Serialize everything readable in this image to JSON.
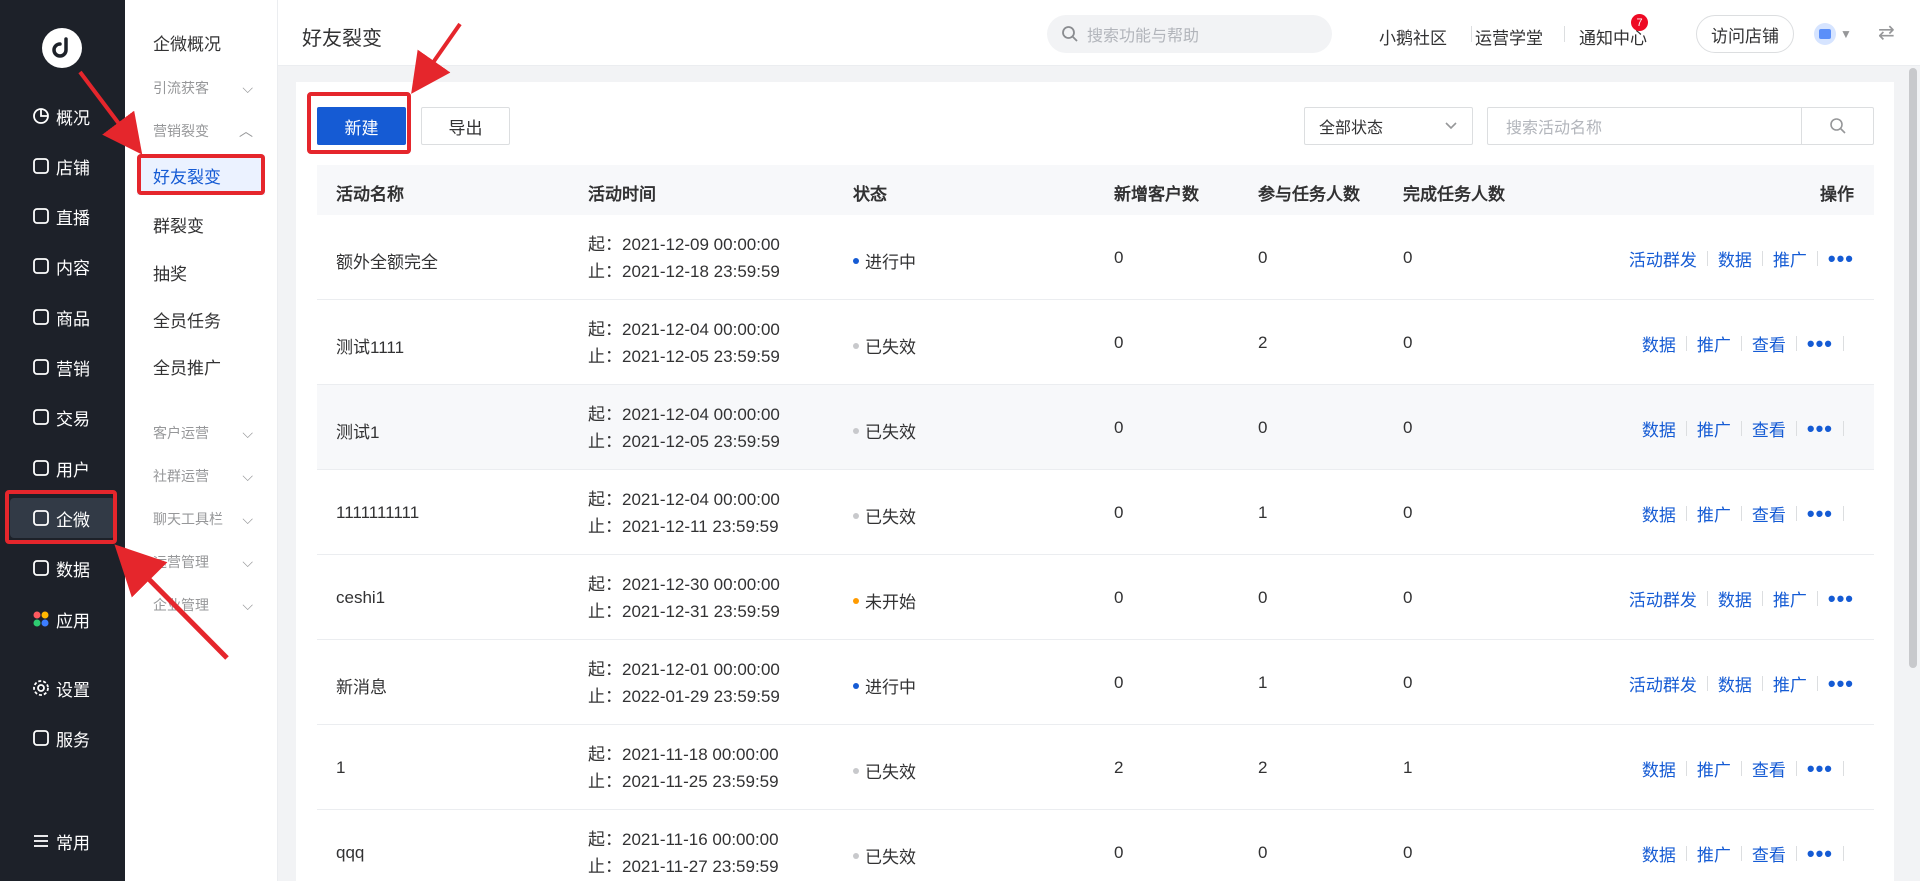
{
  "primary_nav": [
    {
      "label": "概况",
      "icon": "pie-chart-icon"
    },
    {
      "label": "店铺",
      "icon": "store-icon"
    },
    {
      "label": "直播",
      "icon": "live-icon"
    },
    {
      "label": "内容",
      "icon": "document-icon"
    },
    {
      "label": "商品",
      "icon": "product-icon"
    },
    {
      "label": "营销",
      "icon": "megaphone-icon"
    },
    {
      "label": "交易",
      "icon": "transaction-icon"
    },
    {
      "label": "用户",
      "icon": "user-icon"
    },
    {
      "label": "企微",
      "icon": "wecom-icon"
    },
    {
      "label": "数据",
      "icon": "data-icon"
    },
    {
      "label": "应用",
      "icon": "apps-icon"
    },
    {
      "label": "设置",
      "icon": "gear-icon"
    },
    {
      "label": "服务",
      "icon": "service-icon"
    },
    {
      "label": "常用",
      "icon": "menu-icon"
    }
  ],
  "sub_nav": {
    "overview": "企微概况",
    "groups": [
      "引流获客",
      "营销裂变",
      "客户运营",
      "社群运营",
      "聊天工具栏",
      "运营管理",
      "企业管理"
    ],
    "items": [
      "好友裂变",
      "群裂变",
      "抽奖",
      "全员任务",
      "全员推广"
    ]
  },
  "header": {
    "title": "好友裂变",
    "search_placeholder": "搜索功能与帮助",
    "links": [
      "小鹅社区",
      "运营学堂",
      "通知中心"
    ],
    "badge": "7",
    "visit_store": "访问店铺"
  },
  "toolbar": {
    "new_label": "新建",
    "export_label": "导出",
    "status_filter": "全部状态",
    "search_placeholder": "搜索活动名称"
  },
  "table": {
    "columns": [
      "活动名称",
      "活动时间",
      "状态",
      "新增客户数",
      "参与任务人数",
      "完成任务人数",
      "操作"
    ],
    "rows": [
      {
        "name": "额外全额完全",
        "start": "起：2021-12-09 00:00:00",
        "end": "止：2021-12-18 23:59:59",
        "status": "进行中",
        "status_color": "#155bd4",
        "new": "0",
        "joined": "0",
        "done": "0",
        "ops": [
          "活动群发",
          "数据",
          "推广"
        ]
      },
      {
        "name": "测试1111",
        "start": "起：2021-12-04 00:00:00",
        "end": "止：2021-12-05 23:59:59",
        "status": "已失效",
        "status_color": "#c8c9cc",
        "new": "0",
        "joined": "2",
        "done": "0",
        "ops": [
          "数据",
          "推广",
          "查看"
        ]
      },
      {
        "name": "测试1",
        "start": "起：2021-12-04 00:00:00",
        "end": "止：2021-12-05 23:59:59",
        "status": "已失效",
        "status_color": "#c8c9cc",
        "new": "0",
        "joined": "0",
        "done": "0",
        "ops": [
          "数据",
          "推广",
          "查看"
        ]
      },
      {
        "name": "1111111111",
        "start": "起：2021-12-04 00:00:00",
        "end": "止：2021-12-11 23:59:59",
        "status": "已失效",
        "status_color": "#c8c9cc",
        "new": "0",
        "joined": "1",
        "done": "0",
        "ops": [
          "数据",
          "推广",
          "查看"
        ]
      },
      {
        "name": "ceshi1",
        "start": "起：2021-12-30 00:00:00",
        "end": "止：2021-12-31 23:59:59",
        "status": "未开始",
        "status_color": "#ff9b00",
        "new": "0",
        "joined": "0",
        "done": "0",
        "ops": [
          "活动群发",
          "数据",
          "推广"
        ]
      },
      {
        "name": "新消息",
        "start": "起：2021-12-01 00:00:00",
        "end": "止：2022-01-29 23:59:59",
        "status": "进行中",
        "status_color": "#155bd4",
        "new": "0",
        "joined": "1",
        "done": "0",
        "ops": [
          "活动群发",
          "数据",
          "推广"
        ]
      },
      {
        "name": "1",
        "start": "起：2021-11-18 00:00:00",
        "end": "止：2021-11-25 23:59:59",
        "status": "已失效",
        "status_color": "#c8c9cc",
        "new": "2",
        "joined": "2",
        "done": "1",
        "ops": [
          "数据",
          "推广",
          "查看"
        ]
      },
      {
        "name": "qqq",
        "start": "起：2021-11-16 00:00:00",
        "end": "止：2021-11-27 23:59:59",
        "status": "已失效",
        "status_color": "#c8c9cc",
        "new": "0",
        "joined": "0",
        "done": "0",
        "ops": [
          "数据",
          "推广",
          "查看"
        ]
      }
    ]
  },
  "colors": {
    "accent": "#155bd4",
    "highlight": "#e5262c",
    "nav_bg": "#1d2129"
  }
}
